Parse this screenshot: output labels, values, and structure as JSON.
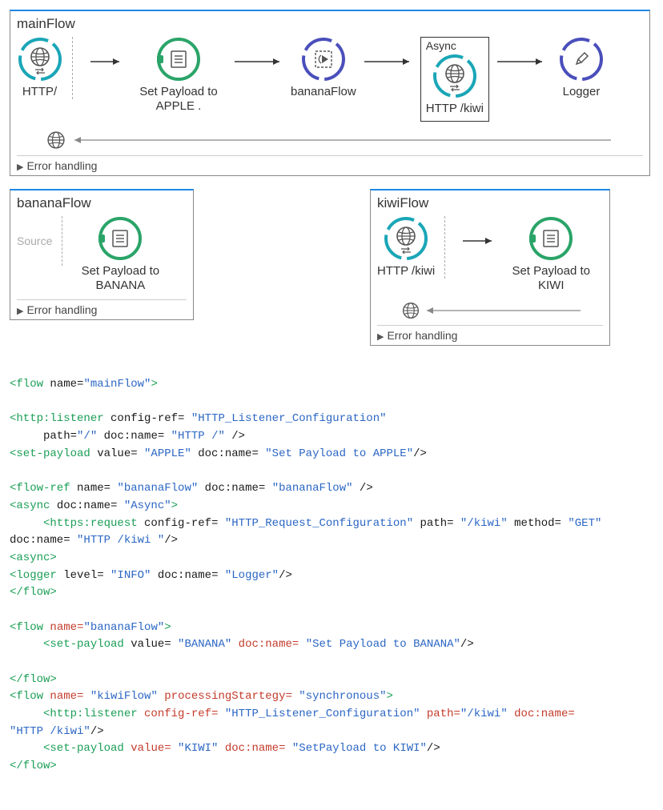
{
  "mainFlow": {
    "title": "mainFlow",
    "nodes": {
      "http": "HTTP/",
      "setPayload": "Set Payload to APPLE .",
      "bananaFlow": "bananaFlow",
      "async": "Async",
      "asyncHttp": "HTTP /kiwi",
      "logger": "Logger"
    },
    "errorHandling": "Error handling"
  },
  "bananaFlow": {
    "title": "bananaFlow",
    "sourcePlaceholder": "Source",
    "setPayload": "Set Payload to BANANA",
    "errorHandling": "Error handling"
  },
  "kiwiFlow": {
    "title": "kiwiFlow",
    "http": "HTTP /kiwi",
    "setPayload": "Set Payload to KIWI",
    "errorHandling": "Error handling"
  },
  "code": {
    "lines": [
      [
        [
          "t-green",
          "<flow "
        ],
        [
          "t-black",
          "name="
        ],
        [
          "t-blue",
          "\"mainFlow\""
        ],
        [
          "t-green",
          ">"
        ]
      ],
      [],
      [
        [
          "t-green",
          "<http:listener "
        ],
        [
          "t-black",
          "config-ref= "
        ],
        [
          "t-blue",
          "\"HTTP_Listener_Configuration\""
        ]
      ],
      [
        [
          "t-black",
          "     path="
        ],
        [
          "t-blue",
          "\"/\""
        ],
        [
          "t-black",
          " doc:name= "
        ],
        [
          "t-blue",
          "\"HTTP /\""
        ],
        [
          "t-black",
          " />"
        ]
      ],
      [
        [
          "t-green",
          "<set-payload "
        ],
        [
          "t-black",
          "value= "
        ],
        [
          "t-blue",
          "\"APPLE\""
        ],
        [
          "t-black",
          " doc:name= "
        ],
        [
          "t-blue",
          "\"Set Payload to APPLE\""
        ],
        [
          "t-black",
          "/>"
        ]
      ],
      [],
      [
        [
          "t-green",
          "<flow-ref "
        ],
        [
          "t-black",
          "name= "
        ],
        [
          "t-blue",
          "\"bananaFlow\""
        ],
        [
          "t-black",
          " doc:name= "
        ],
        [
          "t-blue",
          "\"bananaFlow\""
        ],
        [
          "t-black",
          " />"
        ]
      ],
      [
        [
          "t-green",
          "<async "
        ],
        [
          "t-black",
          "doc:name= "
        ],
        [
          "t-blue",
          "\"Async\""
        ],
        [
          "t-green",
          ">"
        ]
      ],
      [
        [
          "t-green",
          "     <https:request "
        ],
        [
          "t-black",
          "config-ref= "
        ],
        [
          "t-blue",
          "\"HTTP_Request_Configuration\""
        ],
        [
          "t-black",
          " path= "
        ],
        [
          "t-blue",
          "\"/kiwi\""
        ],
        [
          "t-black",
          " method= "
        ],
        [
          "t-blue",
          "\"GET\""
        ]
      ],
      [
        [
          "t-black",
          "doc:name= "
        ],
        [
          "t-blue",
          "\"HTTP /kiwi \""
        ],
        [
          "t-black",
          "/>"
        ]
      ],
      [
        [
          "t-green",
          "<async>"
        ]
      ],
      [
        [
          "t-green",
          "<logger "
        ],
        [
          "t-black",
          "level= "
        ],
        [
          "t-blue",
          "\"INFO\""
        ],
        [
          "t-black",
          " doc:name= "
        ],
        [
          "t-blue",
          "\"Logger\""
        ],
        [
          "t-black",
          "/>"
        ]
      ],
      [
        [
          "t-green",
          "</flow>"
        ]
      ],
      [],
      [
        [
          "t-green",
          "<flow "
        ],
        [
          "t-red",
          "name="
        ],
        [
          "t-blue",
          "\"bananaFlow\""
        ],
        [
          "t-green",
          ">"
        ]
      ],
      [
        [
          "t-green",
          "     <set-payload "
        ],
        [
          "t-black",
          "value= "
        ],
        [
          "t-blue",
          "\"BANANA\""
        ],
        [
          "t-red",
          " doc:name= "
        ],
        [
          "t-blue",
          "\"Set Payload to BANANA\""
        ],
        [
          "t-black",
          "/>"
        ]
      ],
      [],
      [
        [
          "t-green",
          "</flow>"
        ]
      ],
      [
        [
          "t-green",
          "<flow "
        ],
        [
          "t-red",
          "name= "
        ],
        [
          "t-blue",
          "\"kiwiFlow\""
        ],
        [
          "t-red",
          " processingStartegy= "
        ],
        [
          "t-blue",
          "\"synchronous\""
        ],
        [
          "t-green",
          ">"
        ]
      ],
      [
        [
          "t-green",
          "     <http:listener "
        ],
        [
          "t-red",
          "config-ref= "
        ],
        [
          "t-blue",
          "\"HTTP_Listener_Configuration\""
        ],
        [
          "t-red",
          " path="
        ],
        [
          "t-blue",
          "\"/kiwi\""
        ],
        [
          "t-red",
          " doc:name="
        ]
      ],
      [
        [
          "t-blue",
          "\"HTTP /kiwi\""
        ],
        [
          "t-black",
          "/>"
        ]
      ],
      [
        [
          "t-green",
          "     <set-payload "
        ],
        [
          "t-red",
          "value= "
        ],
        [
          "t-blue",
          "\"KIWI\""
        ],
        [
          "t-red",
          " doc:name= "
        ],
        [
          "t-blue",
          "\"SetPayload to KIWI\""
        ],
        [
          "t-black",
          "/>"
        ]
      ],
      [
        [
          "t-green",
          "</flow>"
        ]
      ]
    ]
  }
}
